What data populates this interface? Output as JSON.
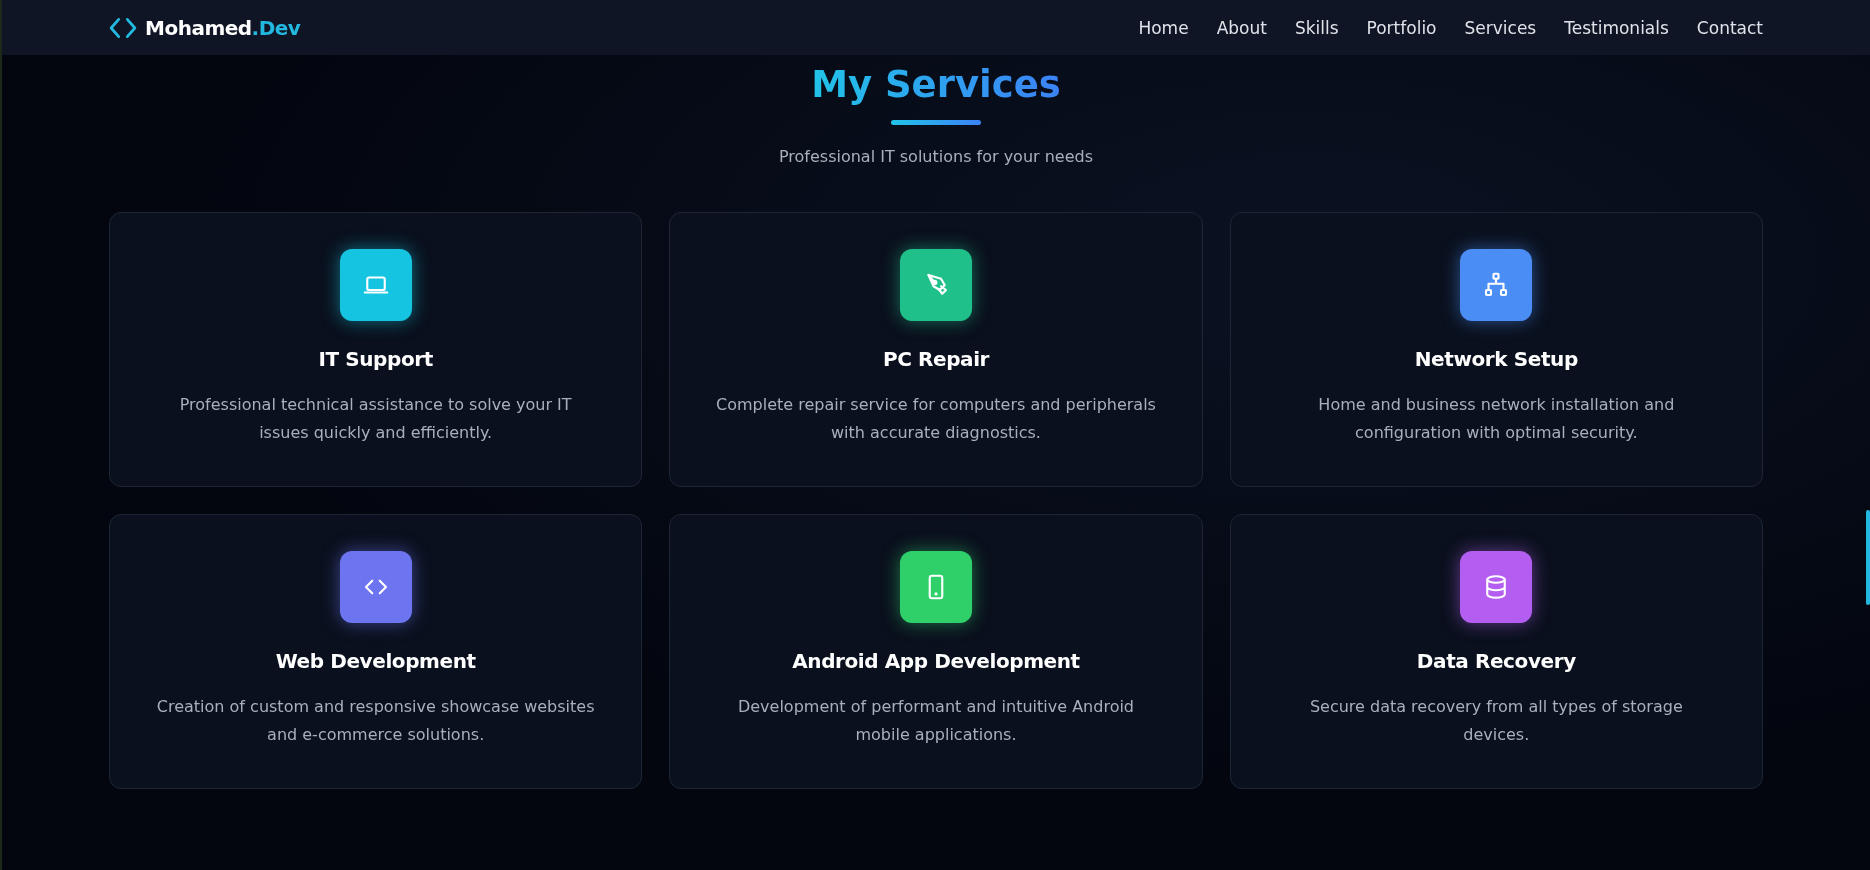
{
  "header": {
    "logo": {
      "name": "Mohamed",
      "accent": ".Dev"
    },
    "nav": [
      {
        "label": "Home",
        "selected": false
      },
      {
        "label": "About",
        "selected": false
      },
      {
        "label": "Skills",
        "selected": false
      },
      {
        "label": "Portfolio",
        "selected": false
      },
      {
        "label": "Services",
        "selected": false
      },
      {
        "label": "Testimonials",
        "selected": false
      },
      {
        "label": "Contact",
        "selected": false
      }
    ]
  },
  "section": {
    "title": "My Services",
    "subtitle": "Professional IT solutions for your needs"
  },
  "services": [
    {
      "title": "IT Support",
      "description": "Professional technical assistance to solve your IT issues quickly and efficiently.",
      "color": "#14c4e0"
    },
    {
      "title": "PC Repair",
      "description": "Complete repair service for computers and peripherals with accurate diagnostics.",
      "color": "#20c08a"
    },
    {
      "title": "Network Setup",
      "description": "Home and business network installation and configuration with optimal security.",
      "color": "#4a8ef5"
    },
    {
      "title": "Web Development",
      "description": "Creation of custom and responsive showcase websites and e-commerce solutions.",
      "color": "#6d74f0"
    },
    {
      "title": "Android App Development",
      "description": "Development of performant and intuitive Android mobile applications.",
      "color": "#2fcf6a"
    },
    {
      "title": "Data Recovery",
      "description": "Secure data recovery from all types of storage devices.",
      "color": "#b35ef0"
    }
  ]
}
